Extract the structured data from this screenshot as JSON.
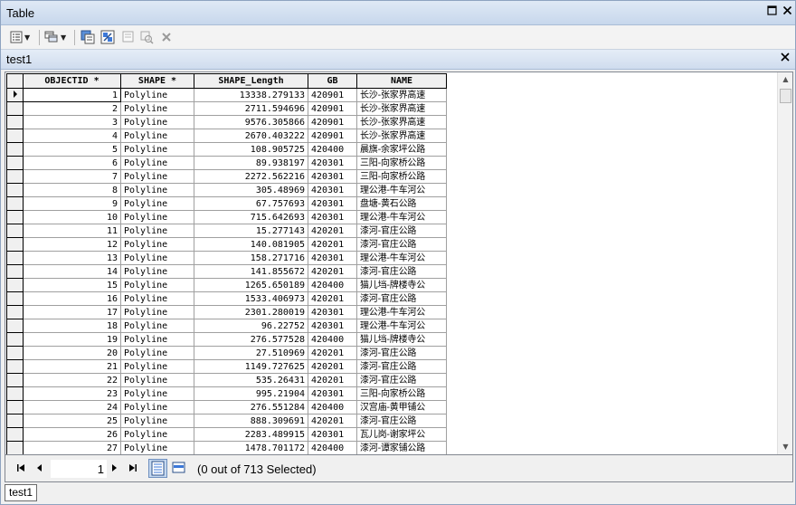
{
  "window": {
    "title": "Table"
  },
  "icons": {
    "table_options": "table-options-icon",
    "related_tables": "related-tables-icon",
    "select_by_attributes": "select-by-attributes-icon",
    "switch_selection": "switch-selection-icon",
    "clear_selection": "clear-selection-icon",
    "zoom_to_selected": "zoom-to-selected-icon",
    "delete_selected": "delete-selected-icon"
  },
  "tab": {
    "title": "test1"
  },
  "grid": {
    "columns": [
      "OBJECTID *",
      "SHAPE *",
      "SHAPE_Length",
      "GB",
      "NAME"
    ],
    "rows": [
      [
        "1",
        "Polyline",
        "13338.279133",
        "420901",
        "长沙-张家界高速"
      ],
      [
        "2",
        "Polyline",
        "2711.594696",
        "420901",
        "长沙-张家界高速"
      ],
      [
        "3",
        "Polyline",
        "9576.305866",
        "420901",
        "长沙-张家界高速"
      ],
      [
        "4",
        "Polyline",
        "2670.403222",
        "420901",
        "长沙-张家界高速"
      ],
      [
        "5",
        "Polyline",
        "108.905725",
        "420400",
        "晨旗-余家坪公路"
      ],
      [
        "6",
        "Polyline",
        "89.938197",
        "420301",
        "三阳-向家桥公路"
      ],
      [
        "7",
        "Polyline",
        "2272.562216",
        "420301",
        "三阳-向家桥公路"
      ],
      [
        "8",
        "Polyline",
        "305.48969",
        "420301",
        "理公港-牛车河公"
      ],
      [
        "9",
        "Polyline",
        "67.757693",
        "420301",
        "盘塘-黄石公路"
      ],
      [
        "10",
        "Polyline",
        "715.642693",
        "420301",
        "理公港-牛车河公"
      ],
      [
        "11",
        "Polyline",
        "15.277143",
        "420201",
        "漆河-官庄公路"
      ],
      [
        "12",
        "Polyline",
        "140.081905",
        "420201",
        "漆河-官庄公路"
      ],
      [
        "13",
        "Polyline",
        "158.271716",
        "420301",
        "理公港-牛车河公"
      ],
      [
        "14",
        "Polyline",
        "141.855672",
        "420201",
        "漆河-官庄公路"
      ],
      [
        "15",
        "Polyline",
        "1265.650189",
        "420400",
        "猫儿垱-牌楼寺公"
      ],
      [
        "16",
        "Polyline",
        "1533.406973",
        "420201",
        "漆河-官庄公路"
      ],
      [
        "17",
        "Polyline",
        "2301.280019",
        "420301",
        "理公港-牛车河公"
      ],
      [
        "18",
        "Polyline",
        "96.22752",
        "420301",
        "理公港-牛车河公"
      ],
      [
        "19",
        "Polyline",
        "276.577528",
        "420400",
        "猫儿垱-牌楼寺公"
      ],
      [
        "20",
        "Polyline",
        "27.510969",
        "420201",
        "漆河-官庄公路"
      ],
      [
        "21",
        "Polyline",
        "1149.727625",
        "420201",
        "漆河-官庄公路"
      ],
      [
        "22",
        "Polyline",
        "535.26431",
        "420201",
        "漆河-官庄公路"
      ],
      [
        "23",
        "Polyline",
        "995.21904",
        "420301",
        "三阳-向家桥公路"
      ],
      [
        "24",
        "Polyline",
        "276.551284",
        "420400",
        "汉宫庙-黄甲铺公"
      ],
      [
        "25",
        "Polyline",
        "888.309691",
        "420201",
        "漆河-官庄公路"
      ],
      [
        "26",
        "Polyline",
        "2283.489915",
        "420301",
        "瓦儿岗-谢家坪公"
      ],
      [
        "27",
        "Polyline",
        "1478.701172",
        "420400",
        "漆河-谭家铺公路"
      ]
    ]
  },
  "navigation": {
    "current_record": "1",
    "selection_status": "(0 out of 713 Selected)"
  },
  "bottom_tabs": [
    "test1"
  ]
}
